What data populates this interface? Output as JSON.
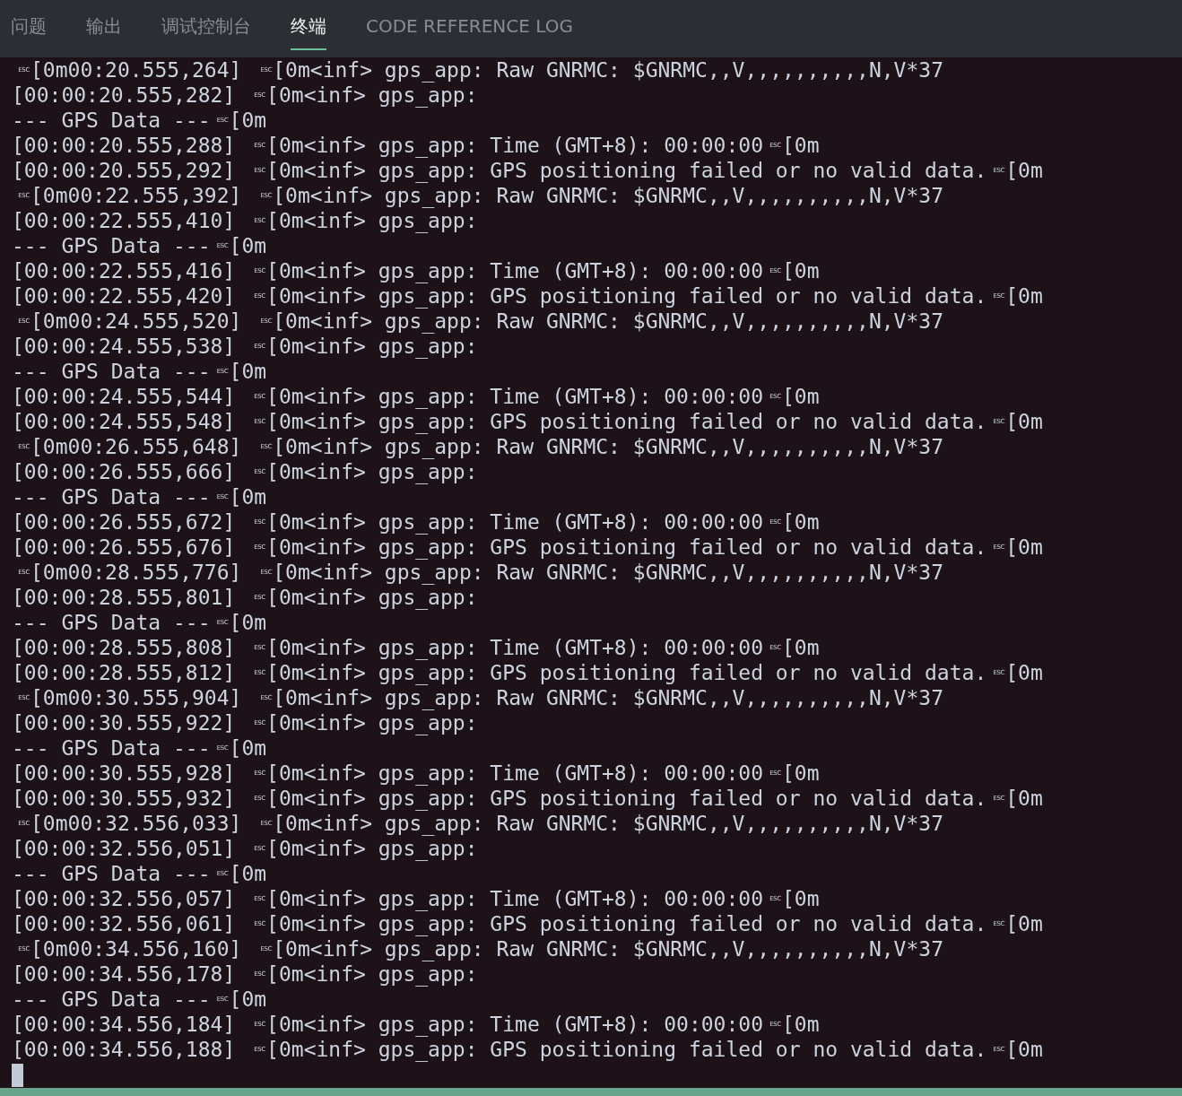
{
  "tabs": [
    {
      "label": "问题",
      "selected": false
    },
    {
      "label": "输出",
      "selected": false
    },
    {
      "label": "调试控制台",
      "selected": false
    },
    {
      "label": "终端",
      "selected": true
    },
    {
      "label": "CODE REFERENCE LOG",
      "selected": false
    }
  ],
  "terminal": {
    "lines": [
      [
        {
          "kind": "esc",
          "text": "ESC"
        },
        {
          "kind": "text",
          "text": "[0m00:20.555,264] "
        },
        {
          "kind": "esc",
          "text": "ESC"
        },
        {
          "kind": "text",
          "text": "[0m<inf> gps_app: Raw GNRMC: $GNRMC,,V,,,,,,,,,,N,V*37"
        }
      ],
      [
        {
          "kind": "text",
          "text": "[00:00:20.555,282] "
        },
        {
          "kind": "esc",
          "text": "ESC"
        },
        {
          "kind": "text",
          "text": "[0m<inf> gps_app:"
        }
      ],
      [
        {
          "kind": "text",
          "text": "--- GPS Data ---"
        },
        {
          "kind": "esc",
          "text": "ESC"
        },
        {
          "kind": "text",
          "text": "[0m"
        }
      ],
      [
        {
          "kind": "text",
          "text": "[00:00:20.555,288] "
        },
        {
          "kind": "esc",
          "text": "ESC"
        },
        {
          "kind": "text",
          "text": "[0m<inf> gps_app: Time (GMT+8): 00:00:00"
        },
        {
          "kind": "esc",
          "text": "ESC"
        },
        {
          "kind": "text",
          "text": "[0m"
        }
      ],
      [
        {
          "kind": "text",
          "text": "[00:00:20.555,292] "
        },
        {
          "kind": "esc",
          "text": "ESC"
        },
        {
          "kind": "text",
          "text": "[0m<inf> gps_app: GPS positioning failed or no valid data."
        },
        {
          "kind": "esc",
          "text": "ESC"
        },
        {
          "kind": "text",
          "text": "[0m"
        }
      ],
      [
        {
          "kind": "esc",
          "text": "ESC"
        },
        {
          "kind": "text",
          "text": "[0m00:22.555,392] "
        },
        {
          "kind": "esc",
          "text": "ESC"
        },
        {
          "kind": "text",
          "text": "[0m<inf> gps_app: Raw GNRMC: $GNRMC,,V,,,,,,,,,,N,V*37"
        }
      ],
      [
        {
          "kind": "text",
          "text": "[00:00:22.555,410] "
        },
        {
          "kind": "esc",
          "text": "ESC"
        },
        {
          "kind": "text",
          "text": "[0m<inf> gps_app:"
        }
      ],
      [
        {
          "kind": "text",
          "text": "--- GPS Data ---"
        },
        {
          "kind": "esc",
          "text": "ESC"
        },
        {
          "kind": "text",
          "text": "[0m"
        }
      ],
      [
        {
          "kind": "text",
          "text": "[00:00:22.555,416] "
        },
        {
          "kind": "esc",
          "text": "ESC"
        },
        {
          "kind": "text",
          "text": "[0m<inf> gps_app: Time (GMT+8): 00:00:00"
        },
        {
          "kind": "esc",
          "text": "ESC"
        },
        {
          "kind": "text",
          "text": "[0m"
        }
      ],
      [
        {
          "kind": "text",
          "text": "[00:00:22.555,420] "
        },
        {
          "kind": "esc",
          "text": "ESC"
        },
        {
          "kind": "text",
          "text": "[0m<inf> gps_app: GPS positioning failed or no valid data."
        },
        {
          "kind": "esc",
          "text": "ESC"
        },
        {
          "kind": "text",
          "text": "[0m"
        }
      ],
      [
        {
          "kind": "esc",
          "text": "ESC"
        },
        {
          "kind": "text",
          "text": "[0m00:24.555,520] "
        },
        {
          "kind": "esc",
          "text": "ESC"
        },
        {
          "kind": "text",
          "text": "[0m<inf> gps_app: Raw GNRMC: $GNRMC,,V,,,,,,,,,,N,V*37"
        }
      ],
      [
        {
          "kind": "text",
          "text": "[00:00:24.555,538] "
        },
        {
          "kind": "esc",
          "text": "ESC"
        },
        {
          "kind": "text",
          "text": "[0m<inf> gps_app:"
        }
      ],
      [
        {
          "kind": "text",
          "text": "--- GPS Data ---"
        },
        {
          "kind": "esc",
          "text": "ESC"
        },
        {
          "kind": "text",
          "text": "[0m"
        }
      ],
      [
        {
          "kind": "text",
          "text": "[00:00:24.555,544] "
        },
        {
          "kind": "esc",
          "text": "ESC"
        },
        {
          "kind": "text",
          "text": "[0m<inf> gps_app: Time (GMT+8): 00:00:00"
        },
        {
          "kind": "esc",
          "text": "ESC"
        },
        {
          "kind": "text",
          "text": "[0m"
        }
      ],
      [
        {
          "kind": "text",
          "text": "[00:00:24.555,548] "
        },
        {
          "kind": "esc",
          "text": "ESC"
        },
        {
          "kind": "text",
          "text": "[0m<inf> gps_app: GPS positioning failed or no valid data."
        },
        {
          "kind": "esc",
          "text": "ESC"
        },
        {
          "kind": "text",
          "text": "[0m"
        }
      ],
      [
        {
          "kind": "esc",
          "text": "ESC"
        },
        {
          "kind": "text",
          "text": "[0m00:26.555,648] "
        },
        {
          "kind": "esc",
          "text": "ESC"
        },
        {
          "kind": "text",
          "text": "[0m<inf> gps_app: Raw GNRMC: $GNRMC,,V,,,,,,,,,,N,V*37"
        }
      ],
      [
        {
          "kind": "text",
          "text": "[00:00:26.555,666] "
        },
        {
          "kind": "esc",
          "text": "ESC"
        },
        {
          "kind": "text",
          "text": "[0m<inf> gps_app:"
        }
      ],
      [
        {
          "kind": "text",
          "text": "--- GPS Data ---"
        },
        {
          "kind": "esc",
          "text": "ESC"
        },
        {
          "kind": "text",
          "text": "[0m"
        }
      ],
      [
        {
          "kind": "text",
          "text": "[00:00:26.555,672] "
        },
        {
          "kind": "esc",
          "text": "ESC"
        },
        {
          "kind": "text",
          "text": "[0m<inf> gps_app: Time (GMT+8): 00:00:00"
        },
        {
          "kind": "esc",
          "text": "ESC"
        },
        {
          "kind": "text",
          "text": "[0m"
        }
      ],
      [
        {
          "kind": "text",
          "text": "[00:00:26.555,676] "
        },
        {
          "kind": "esc",
          "text": "ESC"
        },
        {
          "kind": "text",
          "text": "[0m<inf> gps_app: GPS positioning failed or no valid data."
        },
        {
          "kind": "esc",
          "text": "ESC"
        },
        {
          "kind": "text",
          "text": "[0m"
        }
      ],
      [
        {
          "kind": "esc",
          "text": "ESC"
        },
        {
          "kind": "text",
          "text": "[0m00:28.555,776] "
        },
        {
          "kind": "esc",
          "text": "ESC"
        },
        {
          "kind": "text",
          "text": "[0m<inf> gps_app: Raw GNRMC: $GNRMC,,V,,,,,,,,,,N,V*37"
        }
      ],
      [
        {
          "kind": "text",
          "text": "[00:00:28.555,801] "
        },
        {
          "kind": "esc",
          "text": "ESC"
        },
        {
          "kind": "text",
          "text": "[0m<inf> gps_app:"
        }
      ],
      [
        {
          "kind": "text",
          "text": "--- GPS Data ---"
        },
        {
          "kind": "esc",
          "text": "ESC"
        },
        {
          "kind": "text",
          "text": "[0m"
        }
      ],
      [
        {
          "kind": "text",
          "text": "[00:00:28.555,808] "
        },
        {
          "kind": "esc",
          "text": "ESC"
        },
        {
          "kind": "text",
          "text": "[0m<inf> gps_app: Time (GMT+8): 00:00:00"
        },
        {
          "kind": "esc",
          "text": "ESC"
        },
        {
          "kind": "text",
          "text": "[0m"
        }
      ],
      [
        {
          "kind": "text",
          "text": "[00:00:28.555,812] "
        },
        {
          "kind": "esc",
          "text": "ESC"
        },
        {
          "kind": "text",
          "text": "[0m<inf> gps_app: GPS positioning failed or no valid data."
        },
        {
          "kind": "esc",
          "text": "ESC"
        },
        {
          "kind": "text",
          "text": "[0m"
        }
      ],
      [
        {
          "kind": "esc",
          "text": "ESC"
        },
        {
          "kind": "text",
          "text": "[0m00:30.555,904] "
        },
        {
          "kind": "esc",
          "text": "ESC"
        },
        {
          "kind": "text",
          "text": "[0m<inf> gps_app: Raw GNRMC: $GNRMC,,V,,,,,,,,,,N,V*37"
        }
      ],
      [
        {
          "kind": "text",
          "text": "[00:00:30.555,922] "
        },
        {
          "kind": "esc",
          "text": "ESC"
        },
        {
          "kind": "text",
          "text": "[0m<inf> gps_app:"
        }
      ],
      [
        {
          "kind": "text",
          "text": "--- GPS Data ---"
        },
        {
          "kind": "esc",
          "text": "ESC"
        },
        {
          "kind": "text",
          "text": "[0m"
        }
      ],
      [
        {
          "kind": "text",
          "text": "[00:00:30.555,928] "
        },
        {
          "kind": "esc",
          "text": "ESC"
        },
        {
          "kind": "text",
          "text": "[0m<inf> gps_app: Time (GMT+8): 00:00:00"
        },
        {
          "kind": "esc",
          "text": "ESC"
        },
        {
          "kind": "text",
          "text": "[0m"
        }
      ],
      [
        {
          "kind": "text",
          "text": "[00:00:30.555,932] "
        },
        {
          "kind": "esc",
          "text": "ESC"
        },
        {
          "kind": "text",
          "text": "[0m<inf> gps_app: GPS positioning failed or no valid data."
        },
        {
          "kind": "esc",
          "text": "ESC"
        },
        {
          "kind": "text",
          "text": "[0m"
        }
      ],
      [
        {
          "kind": "esc",
          "text": "ESC"
        },
        {
          "kind": "text",
          "text": "[0m00:32.556,033] "
        },
        {
          "kind": "esc",
          "text": "ESC"
        },
        {
          "kind": "text",
          "text": "[0m<inf> gps_app: Raw GNRMC: $GNRMC,,V,,,,,,,,,,N,V*37"
        }
      ],
      [
        {
          "kind": "text",
          "text": "[00:00:32.556,051] "
        },
        {
          "kind": "esc",
          "text": "ESC"
        },
        {
          "kind": "text",
          "text": "[0m<inf> gps_app:"
        }
      ],
      [
        {
          "kind": "text",
          "text": "--- GPS Data ---"
        },
        {
          "kind": "esc",
          "text": "ESC"
        },
        {
          "kind": "text",
          "text": "[0m"
        }
      ],
      [
        {
          "kind": "text",
          "text": "[00:00:32.556,057] "
        },
        {
          "kind": "esc",
          "text": "ESC"
        },
        {
          "kind": "text",
          "text": "[0m<inf> gps_app: Time (GMT+8): 00:00:00"
        },
        {
          "kind": "esc",
          "text": "ESC"
        },
        {
          "kind": "text",
          "text": "[0m"
        }
      ],
      [
        {
          "kind": "text",
          "text": "[00:00:32.556,061] "
        },
        {
          "kind": "esc",
          "text": "ESC"
        },
        {
          "kind": "text",
          "text": "[0m<inf> gps_app: GPS positioning failed or no valid data."
        },
        {
          "kind": "esc",
          "text": "ESC"
        },
        {
          "kind": "text",
          "text": "[0m"
        }
      ],
      [
        {
          "kind": "esc",
          "text": "ESC"
        },
        {
          "kind": "text",
          "text": "[0m00:34.556,160] "
        },
        {
          "kind": "esc",
          "text": "ESC"
        },
        {
          "kind": "text",
          "text": "[0m<inf> gps_app: Raw GNRMC: $GNRMC,,V,,,,,,,,,,N,V*37"
        }
      ],
      [
        {
          "kind": "text",
          "text": "[00:00:34.556,178] "
        },
        {
          "kind": "esc",
          "text": "ESC"
        },
        {
          "kind": "text",
          "text": "[0m<inf> gps_app:"
        }
      ],
      [
        {
          "kind": "text",
          "text": "--- GPS Data ---"
        },
        {
          "kind": "esc",
          "text": "ESC"
        },
        {
          "kind": "text",
          "text": "[0m"
        }
      ],
      [
        {
          "kind": "text",
          "text": "[00:00:34.556,184] "
        },
        {
          "kind": "esc",
          "text": "ESC"
        },
        {
          "kind": "text",
          "text": "[0m<inf> gps_app: Time (GMT+8): 00:00:00"
        },
        {
          "kind": "esc",
          "text": "ESC"
        },
        {
          "kind": "text",
          "text": "[0m"
        }
      ],
      [
        {
          "kind": "text",
          "text": "[00:00:34.556,188] "
        },
        {
          "kind": "esc",
          "text": "ESC"
        },
        {
          "kind": "text",
          "text": "[0m<inf> gps_app: GPS positioning failed or no valid data."
        },
        {
          "kind": "esc",
          "text": "ESC"
        },
        {
          "kind": "text",
          "text": "[0m"
        }
      ]
    ]
  }
}
